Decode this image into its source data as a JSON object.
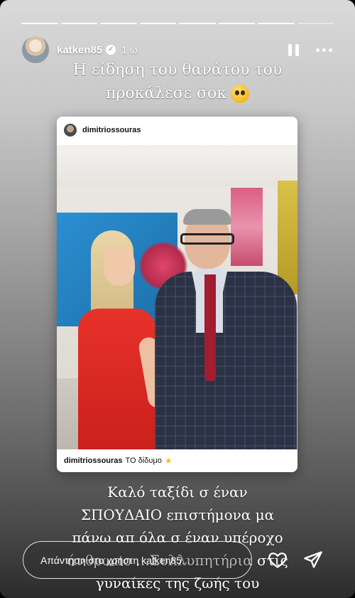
{
  "header": {
    "username": "katken85",
    "time": "1 ω",
    "verified": true
  },
  "progress_segments": 8,
  "caption_top": {
    "line1": "Η είδηση του θανάτου του",
    "line2": "προκάλεσε σοκ",
    "emoji": "pleading-face-icon"
  },
  "post": {
    "username": "dimitriossouras",
    "footer_user": "dimitriossouras",
    "footer_text": "ΤΟ δίδυμο",
    "footer_emoji": "star-icon"
  },
  "caption_bottom": {
    "line1": "Καλό ταξίδι σ έναν",
    "line2": "ΣΠΟΥΔΑΙΟ επιστήμονα μα",
    "line3": "πάνω απ όλα σ έναν υπέροχο",
    "line4": "άνθρωπο ...Συλλυπητήρια στις",
    "line5": "γυναίκες της ζωής του"
  },
  "reply": {
    "placeholder": "Απάντηση στο χρήστη katken85..."
  },
  "colors": {
    "verified": "#3897f0",
    "dress": "#e7322a",
    "star": "#f2c31a"
  }
}
